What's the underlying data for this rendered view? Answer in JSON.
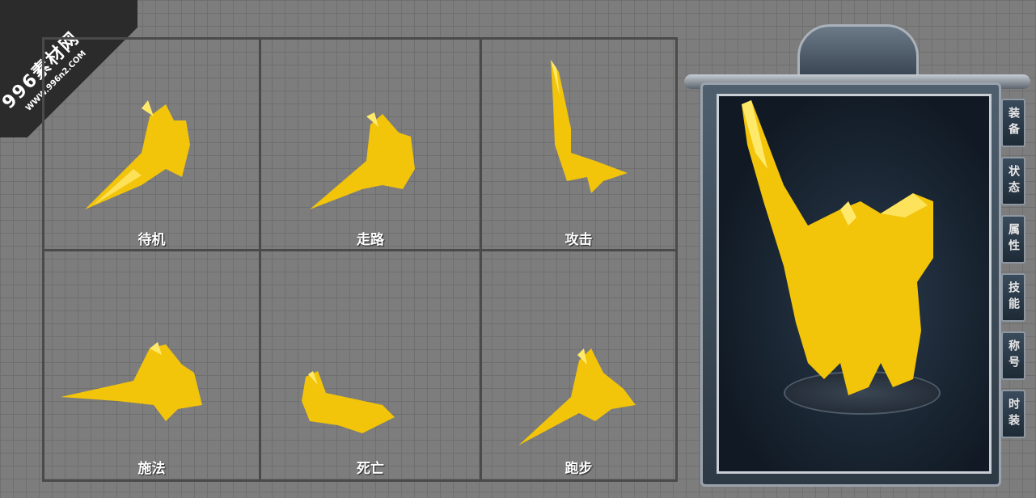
{
  "watermark": {
    "title": "996素材网",
    "url": "WWW.996n2.COM"
  },
  "actions": [
    {
      "label": "待机"
    },
    {
      "label": "走路"
    },
    {
      "label": "攻击"
    },
    {
      "label": "施法"
    },
    {
      "label": "死亡"
    },
    {
      "label": "跑步"
    }
  ],
  "side_tabs": [
    {
      "label": "装备"
    },
    {
      "label": "状态"
    },
    {
      "label": "属性"
    },
    {
      "label": "技能"
    },
    {
      "label": "称号"
    },
    {
      "label": "时装"
    }
  ],
  "colors": {
    "gold": "#f2c40a",
    "gold_light": "#ffe96a",
    "panel": "#2d3944"
  },
  "icons": {
    "character": "golden-armored-warrior-icon"
  }
}
